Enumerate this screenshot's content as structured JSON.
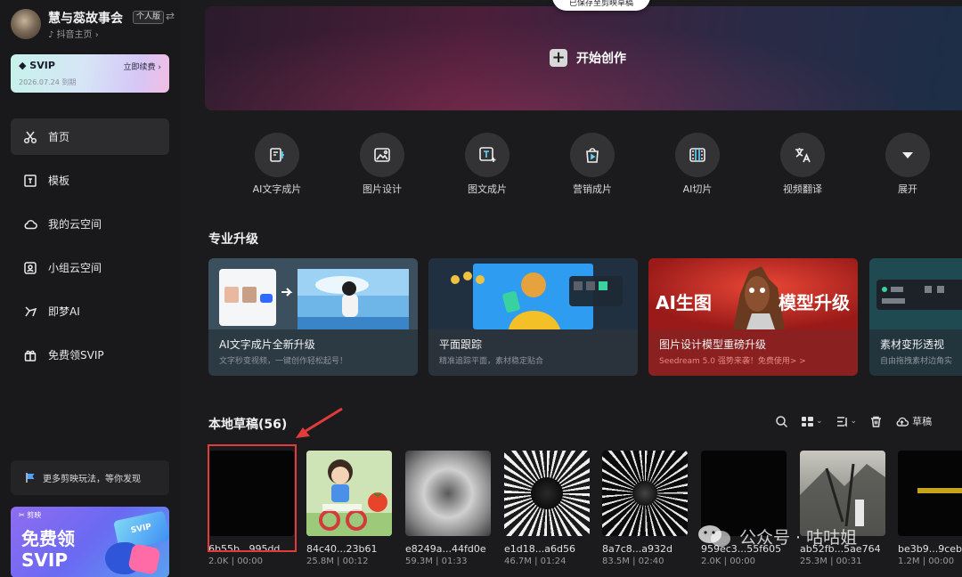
{
  "profile": {
    "name": "慧与蕊故事会",
    "tag": "个人版",
    "sub": "抖音主页"
  },
  "svip": {
    "logo": "SVIP",
    "renew": "立即续费",
    "expiry": "2026.07.24 到期"
  },
  "nav": [
    {
      "label": "首页",
      "icon": "scissors-icon",
      "active": true
    },
    {
      "label": "模板",
      "icon": "template-icon"
    },
    {
      "label": "我的云空间",
      "icon": "cloud-icon"
    },
    {
      "label": "小组云空间",
      "icon": "group-cloud-icon"
    },
    {
      "label": "即梦AI",
      "icon": "dream-ai-icon"
    },
    {
      "label": "免费领SVIP",
      "icon": "gift-icon"
    }
  ],
  "promo": {
    "bar_label": "更多剪映玩法，等你发现",
    "brand": "剪映",
    "big_text": "免费领SVIP",
    "tag": "SVIP"
  },
  "hero": {
    "label": "开始创作",
    "pill": "已保存至剪映草稿"
  },
  "tools": [
    {
      "label": "AI文字成片",
      "icon": "ai-text-video-icon"
    },
    {
      "label": "图片设计",
      "icon": "image-design-icon"
    },
    {
      "label": "图文成片",
      "icon": "image-text-video-icon"
    },
    {
      "label": "营销成片",
      "icon": "marketing-bag-icon"
    },
    {
      "label": "AI切片",
      "icon": "ai-slice-icon"
    },
    {
      "label": "视频翻译",
      "icon": "translate-icon"
    },
    {
      "label": "展开",
      "icon": "expand-icon"
    }
  ],
  "section_title": "专业升级",
  "cards": [
    {
      "title": "AI文字成片全新升级",
      "sub": "文字秒变视频，一键创作轻松起号！"
    },
    {
      "title": "平面跟踪",
      "sub": "精准追踪平面，素材稳定贴合"
    },
    {
      "title": "图片设计模型重磅升级",
      "sub": "Seedream 5.0 强势来袭！免费使用> >",
      "overlay_left": "AI生图",
      "overlay_right": "模型升级"
    },
    {
      "title": "素材变形透视",
      "sub": "自由拖拽素材边角实"
    }
  ],
  "drafts": {
    "title": "本地草稿(56)",
    "cloud_label": "草稿",
    "items": [
      {
        "name": "6b55b...995dd",
        "meta": "2.0K | 00:00"
      },
      {
        "name": "84c40...23b61",
        "meta": "25.8M | 00:12"
      },
      {
        "name": "e8249a...44fd0e",
        "meta": "59.3M | 01:33"
      },
      {
        "name": "e1d18...a6d56",
        "meta": "46.7M | 01:24"
      },
      {
        "name": "8a7c8...a932d",
        "meta": "83.5M | 02:40"
      },
      {
        "name": "959ec3...55f605",
        "meta": "2.0K | 00:00"
      },
      {
        "name": "ab52fb...5ae764",
        "meta": "25.3M | 00:31"
      },
      {
        "name": "be3b9...9ceb",
        "meta": "1.2M | 00:00"
      }
    ]
  },
  "watermark": "公众号 · 咕咕姐"
}
